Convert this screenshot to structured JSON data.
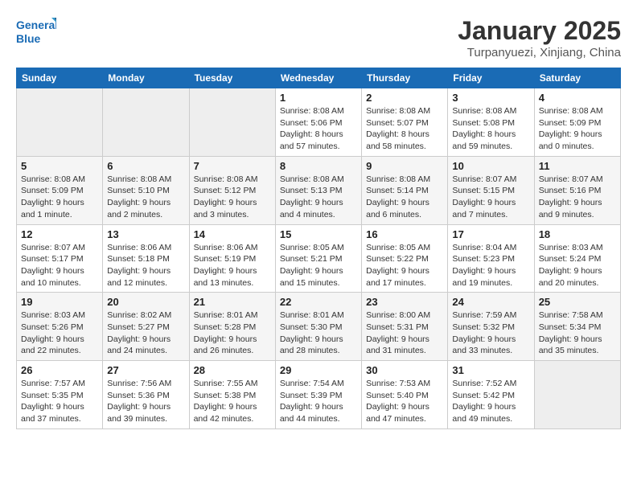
{
  "logo": {
    "line1": "General",
    "line2": "Blue"
  },
  "title": "January 2025",
  "subtitle": "Turpanyuezi, Xinjiang, China",
  "days_of_week": [
    "Sunday",
    "Monday",
    "Tuesday",
    "Wednesday",
    "Thursday",
    "Friday",
    "Saturday"
  ],
  "weeks": [
    [
      {
        "day": "",
        "info": ""
      },
      {
        "day": "",
        "info": ""
      },
      {
        "day": "",
        "info": ""
      },
      {
        "day": "1",
        "info": "Sunrise: 8:08 AM\nSunset: 5:06 PM\nDaylight: 8 hours and 57 minutes."
      },
      {
        "day": "2",
        "info": "Sunrise: 8:08 AM\nSunset: 5:07 PM\nDaylight: 8 hours and 58 minutes."
      },
      {
        "day": "3",
        "info": "Sunrise: 8:08 AM\nSunset: 5:08 PM\nDaylight: 8 hours and 59 minutes."
      },
      {
        "day": "4",
        "info": "Sunrise: 8:08 AM\nSunset: 5:09 PM\nDaylight: 9 hours and 0 minutes."
      }
    ],
    [
      {
        "day": "5",
        "info": "Sunrise: 8:08 AM\nSunset: 5:09 PM\nDaylight: 9 hours and 1 minute."
      },
      {
        "day": "6",
        "info": "Sunrise: 8:08 AM\nSunset: 5:10 PM\nDaylight: 9 hours and 2 minutes."
      },
      {
        "day": "7",
        "info": "Sunrise: 8:08 AM\nSunset: 5:12 PM\nDaylight: 9 hours and 3 minutes."
      },
      {
        "day": "8",
        "info": "Sunrise: 8:08 AM\nSunset: 5:13 PM\nDaylight: 9 hours and 4 minutes."
      },
      {
        "day": "9",
        "info": "Sunrise: 8:08 AM\nSunset: 5:14 PM\nDaylight: 9 hours and 6 minutes."
      },
      {
        "day": "10",
        "info": "Sunrise: 8:07 AM\nSunset: 5:15 PM\nDaylight: 9 hours and 7 minutes."
      },
      {
        "day": "11",
        "info": "Sunrise: 8:07 AM\nSunset: 5:16 PM\nDaylight: 9 hours and 9 minutes."
      }
    ],
    [
      {
        "day": "12",
        "info": "Sunrise: 8:07 AM\nSunset: 5:17 PM\nDaylight: 9 hours and 10 minutes."
      },
      {
        "day": "13",
        "info": "Sunrise: 8:06 AM\nSunset: 5:18 PM\nDaylight: 9 hours and 12 minutes."
      },
      {
        "day": "14",
        "info": "Sunrise: 8:06 AM\nSunset: 5:19 PM\nDaylight: 9 hours and 13 minutes."
      },
      {
        "day": "15",
        "info": "Sunrise: 8:05 AM\nSunset: 5:21 PM\nDaylight: 9 hours and 15 minutes."
      },
      {
        "day": "16",
        "info": "Sunrise: 8:05 AM\nSunset: 5:22 PM\nDaylight: 9 hours and 17 minutes."
      },
      {
        "day": "17",
        "info": "Sunrise: 8:04 AM\nSunset: 5:23 PM\nDaylight: 9 hours and 19 minutes."
      },
      {
        "day": "18",
        "info": "Sunrise: 8:03 AM\nSunset: 5:24 PM\nDaylight: 9 hours and 20 minutes."
      }
    ],
    [
      {
        "day": "19",
        "info": "Sunrise: 8:03 AM\nSunset: 5:26 PM\nDaylight: 9 hours and 22 minutes."
      },
      {
        "day": "20",
        "info": "Sunrise: 8:02 AM\nSunset: 5:27 PM\nDaylight: 9 hours and 24 minutes."
      },
      {
        "day": "21",
        "info": "Sunrise: 8:01 AM\nSunset: 5:28 PM\nDaylight: 9 hours and 26 minutes."
      },
      {
        "day": "22",
        "info": "Sunrise: 8:01 AM\nSunset: 5:30 PM\nDaylight: 9 hours and 28 minutes."
      },
      {
        "day": "23",
        "info": "Sunrise: 8:00 AM\nSunset: 5:31 PM\nDaylight: 9 hours and 31 minutes."
      },
      {
        "day": "24",
        "info": "Sunrise: 7:59 AM\nSunset: 5:32 PM\nDaylight: 9 hours and 33 minutes."
      },
      {
        "day": "25",
        "info": "Sunrise: 7:58 AM\nSunset: 5:34 PM\nDaylight: 9 hours and 35 minutes."
      }
    ],
    [
      {
        "day": "26",
        "info": "Sunrise: 7:57 AM\nSunset: 5:35 PM\nDaylight: 9 hours and 37 minutes."
      },
      {
        "day": "27",
        "info": "Sunrise: 7:56 AM\nSunset: 5:36 PM\nDaylight: 9 hours and 39 minutes."
      },
      {
        "day": "28",
        "info": "Sunrise: 7:55 AM\nSunset: 5:38 PM\nDaylight: 9 hours and 42 minutes."
      },
      {
        "day": "29",
        "info": "Sunrise: 7:54 AM\nSunset: 5:39 PM\nDaylight: 9 hours and 44 minutes."
      },
      {
        "day": "30",
        "info": "Sunrise: 7:53 AM\nSunset: 5:40 PM\nDaylight: 9 hours and 47 minutes."
      },
      {
        "day": "31",
        "info": "Sunrise: 7:52 AM\nSunset: 5:42 PM\nDaylight: 9 hours and 49 minutes."
      },
      {
        "day": "",
        "info": ""
      }
    ]
  ]
}
